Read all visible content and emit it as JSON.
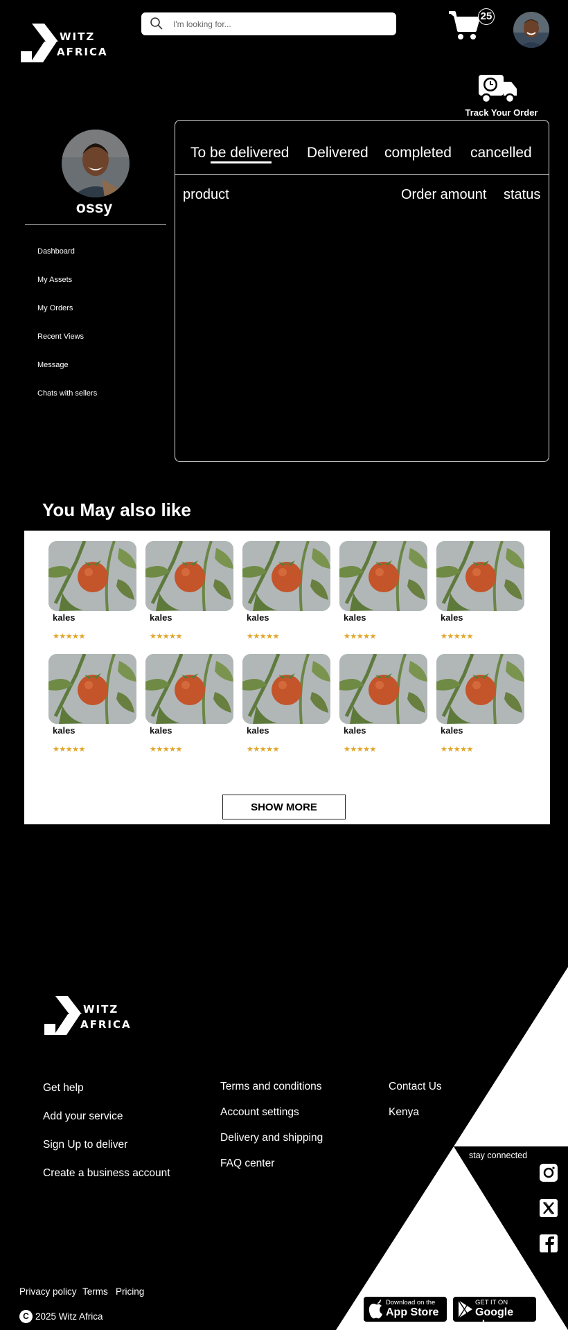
{
  "header": {
    "brand_top": "WITZ",
    "brand_bottom": "AFRICA",
    "search_placeholder": "I'm looking for...",
    "cart_count": "25",
    "track_order_label": "Track Your Order"
  },
  "profile": {
    "username": "ossy"
  },
  "sidebar": {
    "items": [
      {
        "label": "Dashboard"
      },
      {
        "label": "My Assets"
      },
      {
        "label": "My Orders"
      },
      {
        "label": "Recent Views"
      },
      {
        "label": "Message"
      },
      {
        "label": "Chats with sellers"
      }
    ]
  },
  "orders": {
    "tabs": [
      {
        "label": "To be delivered",
        "active": true
      },
      {
        "label": "Delivered"
      },
      {
        "label": "completed"
      },
      {
        "label": "cancelled"
      }
    ],
    "columns": {
      "product": "product",
      "amount": "Order amount",
      "status": "status"
    }
  },
  "recommendations": {
    "title": "You May also like",
    "products": [
      {
        "name": "kales",
        "stars": "★★★★★"
      },
      {
        "name": "kales",
        "stars": "★★★★★"
      },
      {
        "name": "kales",
        "stars": "★★★★★"
      },
      {
        "name": "kales",
        "stars": "★★★★★"
      },
      {
        "name": "kales",
        "stars": "★★★★★"
      },
      {
        "name": "kales",
        "stars": "★★★★★"
      },
      {
        "name": "kales",
        "stars": "★★★★★"
      },
      {
        "name": "kales",
        "stars": "★★★★★"
      },
      {
        "name": "kales",
        "stars": "★★★★★"
      },
      {
        "name": "kales",
        "stars": "★★★★★"
      }
    ],
    "show_more_label": "SHOW MORE"
  },
  "footer": {
    "brand_top": "WITZ",
    "brand_bottom": "AFRICA",
    "col1": [
      "Get help",
      "Add your service",
      "Sign Up to deliver",
      "Create a business account"
    ],
    "col2": [
      "Terms and conditions",
      "Account settings",
      "Delivery and shipping",
      "FAQ center"
    ],
    "col3": [
      "Contact Us",
      "Kenya"
    ],
    "stay_connected": "stay connected",
    "social_icons": [
      "instagram-icon",
      "x-icon",
      "facebook-icon"
    ],
    "bottom_links": [
      "Privacy policy",
      "Terms",
      "Pricing"
    ],
    "copyright": "2025 Witz Africa",
    "copyright_symbol": "C",
    "app_store": {
      "small": "Download on the",
      "big": "App Store"
    },
    "google_play": {
      "small": "GET IT ON",
      "big": "Google play"
    }
  },
  "colors": {
    "background": "#000000",
    "panel": "#ffffff",
    "stars": "#e0a62a"
  }
}
